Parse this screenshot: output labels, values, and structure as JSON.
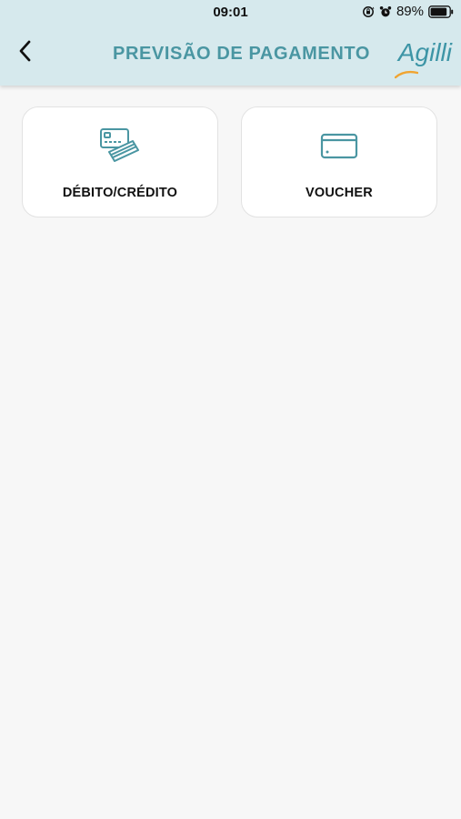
{
  "status_bar": {
    "time": "09:01",
    "battery_percent": "89%",
    "icons": [
      "orientation-lock-icon",
      "alarm-icon",
      "battery-icon"
    ],
    "battery_level": 0.89
  },
  "header": {
    "title": "PREVISÃO DE PAGAMENTO",
    "back_icon": "chevron-left-icon",
    "logo_text": "Agilli"
  },
  "payment_options": [
    {
      "label": "DÉBITO/CRÉDITO",
      "icon": "credit-cards-icon"
    },
    {
      "label": "VOUCHER",
      "icon": "card-icon"
    }
  ],
  "colors": {
    "header_bg": "#d6e9ed",
    "accent": "#4a96a2",
    "logo_accent": "#f0a431",
    "page_bg": "#f7f7f7",
    "card_bg": "#ffffff",
    "card_border": "#e2e2e2"
  }
}
